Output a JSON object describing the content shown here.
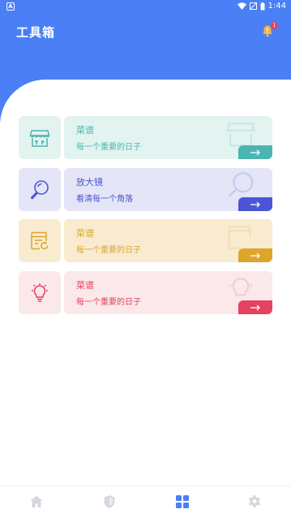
{
  "status_bar": {
    "time": "1:44",
    "left_icon_letter": "A"
  },
  "header": {
    "title": "工具箱",
    "notification_badge": "1"
  },
  "cards": [
    {
      "title": "菜谱",
      "subtitle": "每一个重要的日子",
      "icon": "storefront-icon",
      "colors": {
        "icon_bg": "#e3f3f0",
        "body_bg": "#e3f3f0",
        "accent": "#4bb5b2",
        "text": "#4bb5b2"
      }
    },
    {
      "title": "放大镜",
      "subtitle": "看清每一个角落",
      "icon": "magnifier-icon",
      "colors": {
        "icon_bg": "#e4e5f7",
        "body_bg": "#e4e5f7",
        "accent": "#4b55d6",
        "text": "#4b55d6"
      }
    },
    {
      "title": "菜谱",
      "subtitle": "每一个重要的日子",
      "icon": "document-refresh-icon",
      "colors": {
        "icon_bg": "#f8ebd0",
        "body_bg": "#f8ebd0",
        "accent": "#dda52b",
        "text": "#dda52b"
      }
    },
    {
      "title": "菜谱",
      "subtitle": "每一个重要的日子",
      "icon": "lightbulb-icon",
      "colors": {
        "icon_bg": "#fae8ea",
        "body_bg": "#fae8ea",
        "accent": "#e54260",
        "text": "#e54260"
      }
    }
  ],
  "bottom_nav": [
    {
      "icon": "home-icon",
      "active": false
    },
    {
      "icon": "shield-icon",
      "active": false
    },
    {
      "icon": "grid-icon",
      "active": true
    },
    {
      "icon": "gear-icon",
      "active": false
    }
  ],
  "colors": {
    "primary": "#4a7ff6",
    "nav_inactive": "#d4d7dd"
  }
}
